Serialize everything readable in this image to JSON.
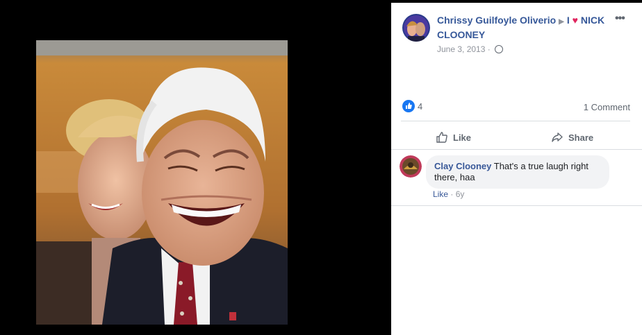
{
  "post": {
    "author": "Chrissy Guilfoyle Oliverio",
    "group_prefix": "I",
    "group_suffix": "NICK CLOONEY",
    "more_label": "•••",
    "date": "June 3, 2013",
    "date_separator": "·",
    "audience_icon": "globe-icon"
  },
  "reactions": {
    "count": "4",
    "comments_label": "1 Comment"
  },
  "actions": {
    "like": "Like",
    "share": "Share"
  },
  "comment": {
    "author": "Clay Clooney",
    "text": "That's a true laugh right there, haa",
    "like_label": "Like",
    "separator": "·",
    "age": "6y"
  },
  "colors": {
    "link": "#365899",
    "like_blue": "#1877f2",
    "heart": "#e0245e",
    "muted": "#90949c"
  }
}
